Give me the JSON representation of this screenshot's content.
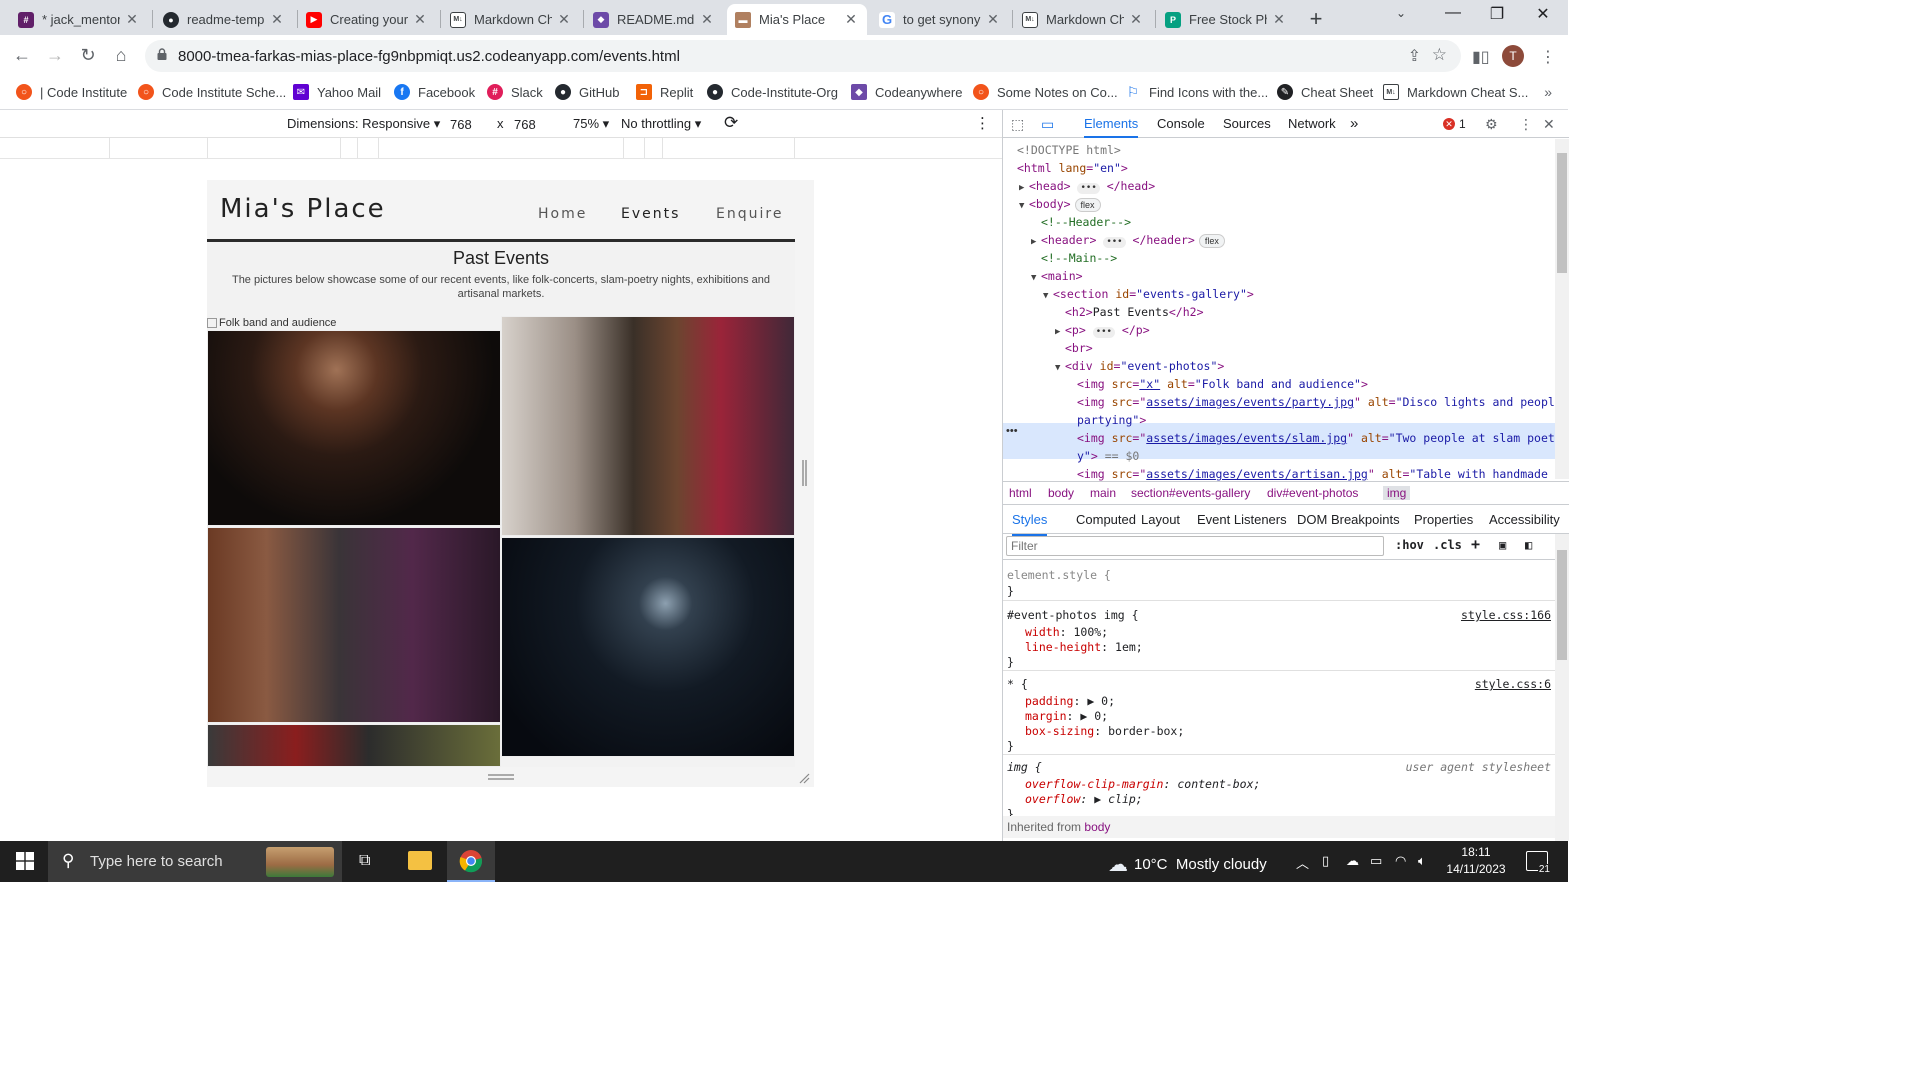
{
  "browser": {
    "tabs": [
      {
        "title": "* jack_mentor",
        "icon": "slack-icon",
        "color": "#611f69"
      },
      {
        "title": "readme-temp",
        "icon": "github-icon",
        "color": "#24292f"
      },
      {
        "title": "Creating your",
        "icon": "youtube-icon",
        "color": "#ff0000"
      },
      {
        "title": "Markdown Ch",
        "icon": "markdown-icon",
        "color": "#3c4043"
      },
      {
        "title": "README.md",
        "icon": "codeanywhere-icon",
        "color": "#6d4aa8"
      },
      {
        "title": "Mia's Place",
        "icon": "site-icon",
        "color": "#b08060",
        "active": true
      },
      {
        "title": "to get synony",
        "icon": "google-icon",
        "color": "#4285f4"
      },
      {
        "title": "Markdown Ch",
        "icon": "markdown-icon",
        "color": "#3c4043"
      },
      {
        "title": "Free Stock Ph",
        "icon": "pexels-icon",
        "color": "#05a081"
      }
    ],
    "url": "8000-tmea-farkas-mias-place-fg9nbpmiqt.us2.codeanyapp.com/events.html",
    "avatar_letter": "T",
    "bookmarks": [
      {
        "label": "| Code Institute",
        "icon": "code-institute-icon",
        "color": "#f2541b"
      },
      {
        "label": "Code Institute Sche...",
        "icon": "code-institute-icon",
        "color": "#f2541b"
      },
      {
        "label": "Yahoo Mail",
        "icon": "yahoo-mail-icon",
        "color": "#6001d2"
      },
      {
        "label": "Facebook",
        "icon": "facebook-icon",
        "color": "#1877f2"
      },
      {
        "label": "Slack",
        "icon": "slack-icon",
        "color": "#e01e5a"
      },
      {
        "label": "GitHub",
        "icon": "github-icon",
        "color": "#24292f"
      },
      {
        "label": "Replit",
        "icon": "replit-icon",
        "color": "#f26207"
      },
      {
        "label": "Code-Institute-Org",
        "icon": "github-icon",
        "color": "#24292f"
      },
      {
        "label": "Codeanywhere",
        "icon": "codeanywhere-icon",
        "color": "#6d4aa8"
      },
      {
        "label": "Some Notes on Co...",
        "icon": "code-institute-icon",
        "color": "#f2541b"
      },
      {
        "label": "Find Icons with the...",
        "icon": "flag-icon",
        "color": "#1a73e8"
      },
      {
        "label": "Cheat Sheet",
        "icon": "cheat-sheet-icon",
        "color": "#202124"
      },
      {
        "label": "Markdown Cheat S...",
        "icon": "markdown-icon",
        "color": "#3c4043"
      }
    ]
  },
  "device_toolbar": {
    "dimensions_label": "Dimensions: Responsive",
    "width": "768",
    "times": "x",
    "height": "768",
    "zoom": "75%",
    "throttling": "No throttling"
  },
  "site": {
    "logo": "Mia's Place",
    "nav": [
      "Home",
      "Events",
      "Enquire"
    ],
    "section_title": "Past Events",
    "section_desc": "The pictures below showcase some of our recent events, like folk-concerts, slam-poetry nights, exhibitions and artisanal markets.",
    "broken_alt": "Folk band and audience"
  },
  "devtools": {
    "tabs": [
      "Elements",
      "Console",
      "Sources",
      "Network"
    ],
    "more": "»",
    "error_count": "1",
    "dom": {
      "doctype": "<!DOCTYPE html>",
      "html_open": "<html",
      "lang_attr": "lang",
      "lang_val": "\"en\"",
      "head": "<head>",
      "head_close": "</head>",
      "body": "<body>",
      "flex": "flex",
      "comment_header": "<!--Header-->",
      "header": "<header>",
      "header_close": "</header>",
      "comment_main": "<!--Main-->",
      "main": "<main>",
      "section_open": "<section",
      "id_attr": "id",
      "section_id": "\"events-gallery\"",
      "h2_open": "<h2>",
      "h2_text": "Past Events",
      "h2_close": "</h2>",
      "p_open": "<p>",
      "p_close": "</p>",
      "br": "<br>",
      "div_open": "<div",
      "div_id": "\"event-photos\"",
      "img_open": "<img",
      "src_attr": "src",
      "alt_attr": "alt",
      "img1_src": "\"x\"",
      "img1_alt": "\"Folk band and audience\"",
      "img2_src": "assets/images/events/party.jpg",
      "img2_alt": "\"Disco lights and people",
      "img2_alt_cont": "partying\"",
      "img3_src": "assets/images/events/slam.jpg",
      "img3_alt": "\"Two people at slam poetr",
      "img3_alt_cont": "y\"",
      "img3_eq": "== $0",
      "img4_src": "assets/images/events/artisan.jpg",
      "img4_alt": "\"Table with handmade h"
    },
    "breadcrumbs": [
      "html",
      "body",
      "main",
      "section#events-gallery",
      "div#event-photos",
      "img"
    ],
    "sub_tabs": [
      "Styles",
      "Computed",
      "Layout",
      "Event Listeners",
      "DOM Breakpoints",
      "Properties",
      "Accessibility"
    ],
    "filter_placeholder": "Filter",
    "hov": ":hov",
    "cls": ".cls",
    "styles": {
      "element_style": "element.style {",
      "close": "}",
      "rule1_selector": "#event-photos img {",
      "rule1_source": "style.css:166",
      "rule1_props": [
        {
          "prop": "width",
          "val": "100%;"
        },
        {
          "prop": "line-height",
          "val": "1em;"
        }
      ],
      "rule2_selector": "* {",
      "rule2_source": "style.css:6",
      "rule2_props": [
        {
          "prop": "padding",
          "val": "▶ 0;"
        },
        {
          "prop": "margin",
          "val": "▶ 0;"
        },
        {
          "prop": "box-sizing",
          "val": "border-box;"
        }
      ],
      "rule3_selector": "img {",
      "rule3_source": "user agent stylesheet",
      "rule3_props": [
        {
          "prop": "overflow-clip-margin",
          "val": "content-box;"
        },
        {
          "prop": "overflow",
          "val": "▶ clip;"
        }
      ],
      "inherited_label": "Inherited from",
      "inherited_from": "body"
    }
  },
  "taskbar": {
    "search_placeholder": "Type here to search",
    "temperature": "10°C",
    "weather": "Mostly cloudy",
    "time": "18:11",
    "date": "14/11/2023",
    "notifications": "21"
  }
}
